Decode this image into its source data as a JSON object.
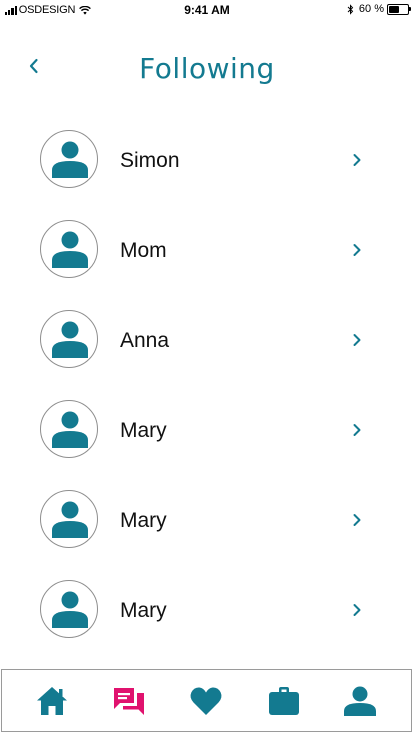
{
  "status_bar": {
    "carrier": "OSDESIGN",
    "time": "9:41 AM",
    "battery_percent": "60 %",
    "battery_level": 0.6
  },
  "header": {
    "title": "Following",
    "back_icon": "chevron-left-icon"
  },
  "following": [
    {
      "name": "Simon"
    },
    {
      "name": "Mom"
    },
    {
      "name": "Anna"
    },
    {
      "name": "Mary"
    },
    {
      "name": "Mary"
    },
    {
      "name": "Mary"
    }
  ],
  "tab_bar": {
    "items": [
      {
        "icon": "home-icon",
        "active": false
      },
      {
        "icon": "chat-icon",
        "active": true
      },
      {
        "icon": "heart-icon",
        "active": false
      },
      {
        "icon": "briefcase-icon",
        "active": false
      },
      {
        "icon": "person-icon",
        "active": false
      }
    ]
  },
  "colors": {
    "accent": "#137a90",
    "active_tab": "#e0126e",
    "text": "#111111",
    "avatar_border": "#8e8e8e"
  }
}
